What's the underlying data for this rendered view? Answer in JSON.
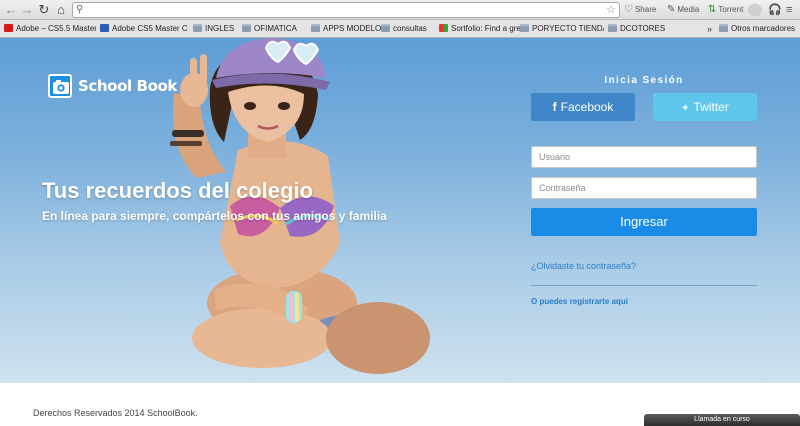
{
  "browser": {
    "omnibox_value": "",
    "extensions": [
      {
        "icon": "share-icon",
        "label": "Share"
      },
      {
        "icon": "media-icon",
        "label": "Media"
      },
      {
        "icon": "torrent-icon",
        "label": "Torrent"
      }
    ],
    "bookmarks": [
      {
        "icon": "adobe-favicon",
        "label": "Adobe – CS5.5 Master..."
      },
      {
        "icon": "tutsplus-favicon",
        "label": "Adobe CS5 Master C..."
      },
      {
        "icon": "folder-icon",
        "label": "INGLES"
      },
      {
        "icon": "folder-icon",
        "label": "OFIMATICA"
      },
      {
        "icon": "folder-icon",
        "label": "APPS MODELOS"
      },
      {
        "icon": "folder-icon",
        "label": "consultas"
      },
      {
        "icon": "sortfolio-favicon",
        "label": "Sortfolio: Find a gre..."
      },
      {
        "icon": "folder-icon",
        "label": "PORYECTO TIENDA"
      },
      {
        "icon": "folder-icon",
        "label": "DCOTORES"
      }
    ],
    "bookmarks_overflow": "»",
    "other_bookmarks": "Otros marcadores"
  },
  "brand": {
    "name": "School Book"
  },
  "hero": {
    "headline": "Tus recuerdos del colegio",
    "subline": "En línea para siempre, compártelos con tus amigos y familia"
  },
  "login": {
    "title": "Inicia Sesión",
    "facebook_label": "Facebook",
    "twitter_label": "Twitter",
    "username_placeholder": "Usuario",
    "password_placeholder": "Contraseña",
    "submit_label": "Ingresar",
    "forgot_link": "¿Olvidaste tu contraseña?",
    "register_prefix": "O puedes",
    "register_link": "registrarte aquí"
  },
  "footer": {
    "copyright": "Derechos Reservados 2014 SchoolBook."
  },
  "call_bar": {
    "label": "Llamada en curso"
  },
  "colors": {
    "facebook": "#3f87c9",
    "twitter": "#5ec6ea",
    "primary": "#1a8ce8",
    "link": "#2a7ec9",
    "sky_top": "#5d9dd6"
  }
}
